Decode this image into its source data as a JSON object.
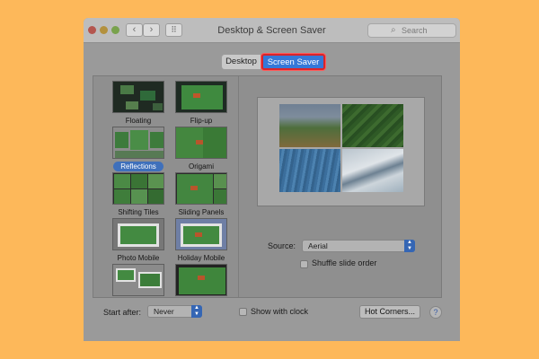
{
  "window": {
    "title": "Desktop & Screen Saver"
  },
  "search": {
    "placeholder": "Search"
  },
  "tabs": [
    {
      "label": "Desktop",
      "selected": false
    },
    {
      "label": "Screen Saver",
      "selected": true
    }
  ],
  "screensavers": [
    {
      "label": "Floating",
      "selected": false
    },
    {
      "label": "Flip-up",
      "selected": false
    },
    {
      "label": "Reflections",
      "selected": true
    },
    {
      "label": "Origami",
      "selected": false
    },
    {
      "label": "Shifting Tiles",
      "selected": false
    },
    {
      "label": "Sliding Panels",
      "selected": false
    },
    {
      "label": "Photo Mobile",
      "selected": false
    },
    {
      "label": "Holiday Mobile",
      "selected": false
    },
    {
      "label": "",
      "selected": false
    },
    {
      "label": "",
      "selected": false
    }
  ],
  "options": {
    "source_label": "Source:",
    "source_value": "Aerial",
    "shuffle_label": "Shuffle slide order",
    "shuffle_checked": false
  },
  "footer": {
    "start_after_label": "Start after:",
    "start_after_value": "Never",
    "show_clock_label": "Show with clock",
    "show_clock_checked": false,
    "hot_corners_label": "Hot Corners...",
    "help_label": "?"
  },
  "colors": {
    "background": "#FDB85A",
    "selected_tab": "#3578d8",
    "highlight_border": "#d8252b",
    "selection": "#3f70bb"
  }
}
